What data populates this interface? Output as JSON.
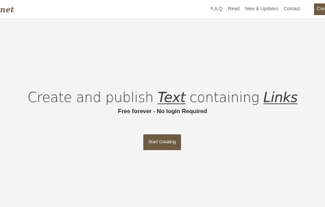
{
  "header": {
    "logo_text": "net",
    "nav": {
      "faq": "F.A.Q",
      "read": "Read",
      "news": "New & Updates",
      "contact": "Contact"
    },
    "cta_label": "Create"
  },
  "hero": {
    "headline_part1": "Create and publish ",
    "headline_text_word": "Text",
    "headline_part2": " containing ",
    "headline_links_word": "Links",
    "subline": "Free forever - No login Required",
    "start_button": "Start Creating"
  },
  "colors": {
    "brand": "#6e5b43",
    "background": "#f4f4f4",
    "header_bg": "#ffffff"
  }
}
